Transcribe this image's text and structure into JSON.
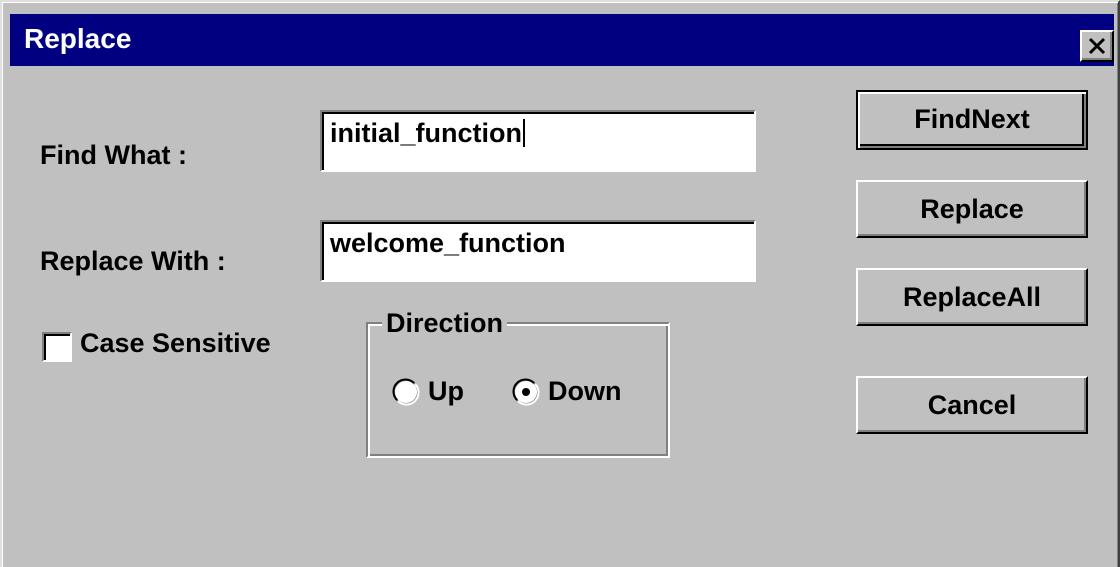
{
  "window": {
    "title": "Replace",
    "close_glyph": "✕"
  },
  "fields": {
    "find_what": {
      "label": "Find What :",
      "value": "initial_function"
    },
    "replace_with": {
      "label": "Replace With :",
      "value": "welcome_function"
    }
  },
  "options": {
    "case_sensitive": {
      "label": "Case Sensitive",
      "checked": false
    }
  },
  "direction": {
    "legend": "Direction",
    "up_label": "Up",
    "down_label": "Down",
    "selected": "Down"
  },
  "buttons": {
    "find_next": "FindNext",
    "replace": "Replace",
    "replace_all": "ReplaceAll",
    "cancel": "Cancel"
  },
  "colors": {
    "titlebar": "#000080",
    "face": "#c0c0c0"
  }
}
